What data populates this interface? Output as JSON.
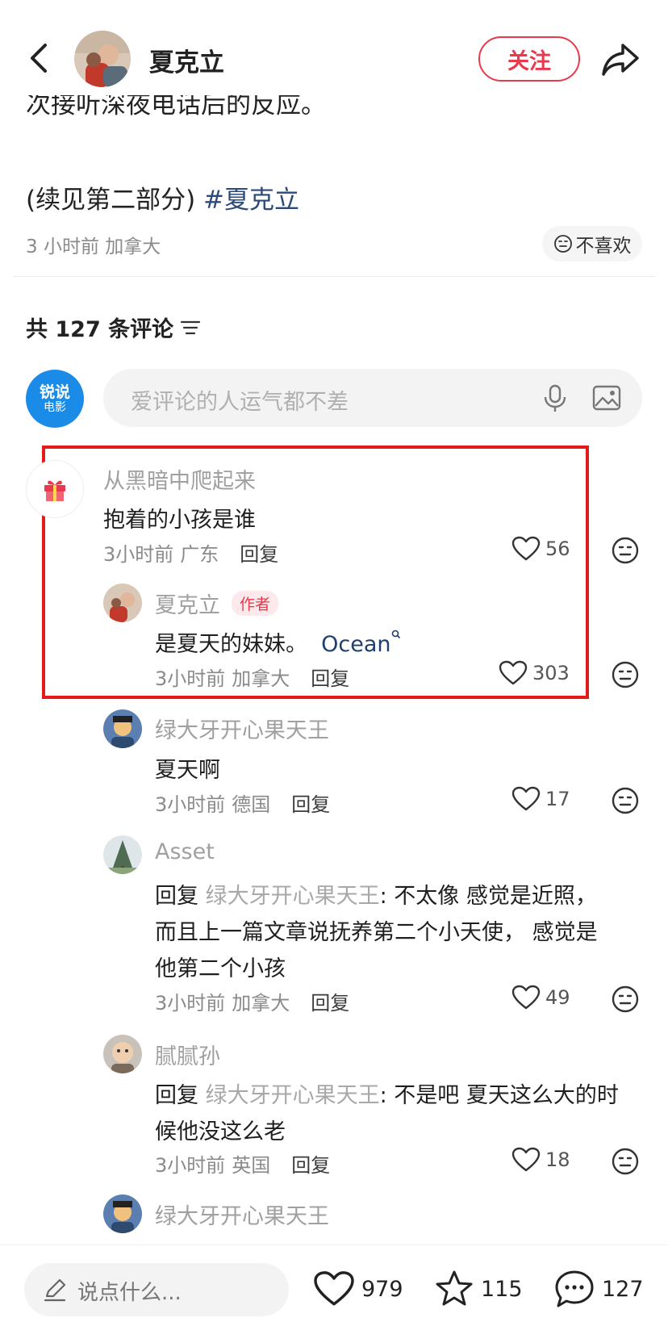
{
  "header": {
    "back_icon": "chevron-left-icon",
    "author_name": "夏克立",
    "follow_label": "关注",
    "share_icon": "share-arrow-icon"
  },
  "post": {
    "cut_text": "次接听深夜电话后的反应。",
    "continued_text": "(续见第二部分) ",
    "hashtag": "#夏克立",
    "meta": "3 小时前 加拿大",
    "dislike_label": "不喜欢"
  },
  "comments_header": {
    "title": "共 127 条评论"
  },
  "comment_input": {
    "brand_line1": "锐说",
    "brand_line2": "电影",
    "placeholder": "爱评论的人运气都不差"
  },
  "comments": [
    {
      "name": "从黑暗中爬起来",
      "text": "抱着的小孩是谁",
      "time": "3小时前",
      "location": "广东",
      "reply_label": "回复",
      "likes": "56"
    },
    {
      "name": "夏克立",
      "author_tag": "作者",
      "text": "是夏天的妹妹。",
      "link_text": "Ocean",
      "time": "3小时前",
      "location": "加拿大",
      "reply_label": "回复",
      "likes": "303"
    },
    {
      "name": "绿大牙开心果天王",
      "text": "夏天啊",
      "time": "3小时前",
      "location": "德国",
      "reply_label": "回复",
      "likes": "17"
    },
    {
      "name": "Asset",
      "reply_prefix": "回复 ",
      "reply_to": "绿大牙开心果天王",
      "text_line1": ": 不太像 感觉是近照，",
      "text_line2": "而且上一篇文章说抚养第二个小天使， 感觉是",
      "text_line3": "他第二个小孩",
      "time": "3小时前",
      "location": "加拿大",
      "reply_label": "回复",
      "likes": "49"
    },
    {
      "name": "腻腻孙",
      "reply_prefix": "回复 ",
      "reply_to": "绿大牙开心果天王",
      "text_line1": ": 不是吧 夏天这么大的时",
      "text_line2": "候他没这么老",
      "time": "3小时前",
      "location": "英国",
      "reply_label": "回复",
      "likes": "18"
    },
    {
      "name": "绿大牙开心果天王"
    }
  ],
  "bottom_bar": {
    "say_placeholder": "说点什么...",
    "like_count": "979",
    "star_count": "115",
    "comment_count": "127"
  },
  "colors": {
    "accent_red": "#e8394d",
    "highlight_red": "#e41a1a",
    "hashtag_blue": "#2b4a7a",
    "brand_blue": "#1a8ce8"
  }
}
